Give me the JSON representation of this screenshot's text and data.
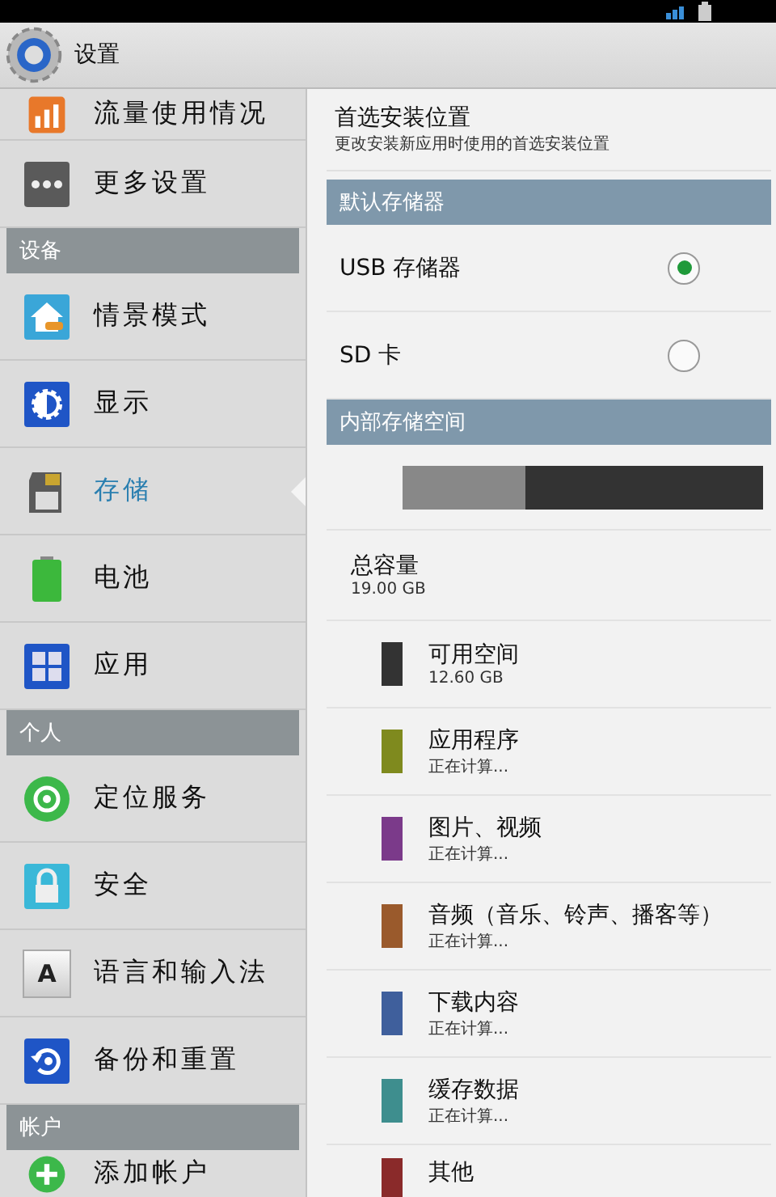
{
  "app_bar": {
    "title": "设置"
  },
  "sidebar": {
    "items": [
      {
        "kind": "item",
        "label": "流量使用情况",
        "selected": false
      },
      {
        "kind": "item",
        "label": "更多设置",
        "selected": false
      },
      {
        "kind": "header",
        "label": "设备"
      },
      {
        "kind": "item",
        "label": "情景模式",
        "selected": false
      },
      {
        "kind": "item",
        "label": "显示",
        "selected": false
      },
      {
        "kind": "item",
        "label": "存储",
        "selected": true
      },
      {
        "kind": "item",
        "label": "电池",
        "selected": false
      },
      {
        "kind": "item",
        "label": "应用",
        "selected": false
      },
      {
        "kind": "header",
        "label": "个人"
      },
      {
        "kind": "item",
        "label": "定位服务",
        "selected": false
      },
      {
        "kind": "item",
        "label": "安全",
        "selected": false
      },
      {
        "kind": "item",
        "label": "语言和输入法",
        "selected": false,
        "icon_letter": "A"
      },
      {
        "kind": "item",
        "label": "备份和重置",
        "selected": false
      },
      {
        "kind": "header",
        "label": "帐户"
      },
      {
        "kind": "item",
        "label": "添加帐户",
        "selected": false
      }
    ]
  },
  "detail": {
    "install_location": {
      "title": "首选安装位置",
      "subtitle": "更改安装新应用时使用的首选安装位置"
    },
    "default_storage": {
      "header": "默认存储器",
      "options": [
        {
          "label": "USB 存储器",
          "selected": true
        },
        {
          "label": "SD 卡",
          "selected": false
        }
      ]
    },
    "internal_storage": {
      "header": "内部存储空间",
      "usage_bar": {
        "level": 0.34
      },
      "total": {
        "label": "总容量",
        "value": "19.00 GB"
      },
      "categories": [
        {
          "label": "可用空间",
          "value": "12.60 GB",
          "color": "#333333"
        },
        {
          "label": "应用程序",
          "value": "正在计算...",
          "color": "#7f8a1e"
        },
        {
          "label": "图片、视频",
          "value": "正在计算...",
          "color": "#7b3a8a"
        },
        {
          "label": "音频（音乐、铃声、播客等）",
          "value": "正在计算...",
          "color": "#9a5a2c"
        },
        {
          "label": "下载内容",
          "value": "正在计算...",
          "color": "#3f5f9c"
        },
        {
          "label": "缓存数据",
          "value": "正在计算...",
          "color": "#3e8e8e"
        },
        {
          "label": "其他",
          "color": "#8a2a2a"
        }
      ]
    }
  }
}
